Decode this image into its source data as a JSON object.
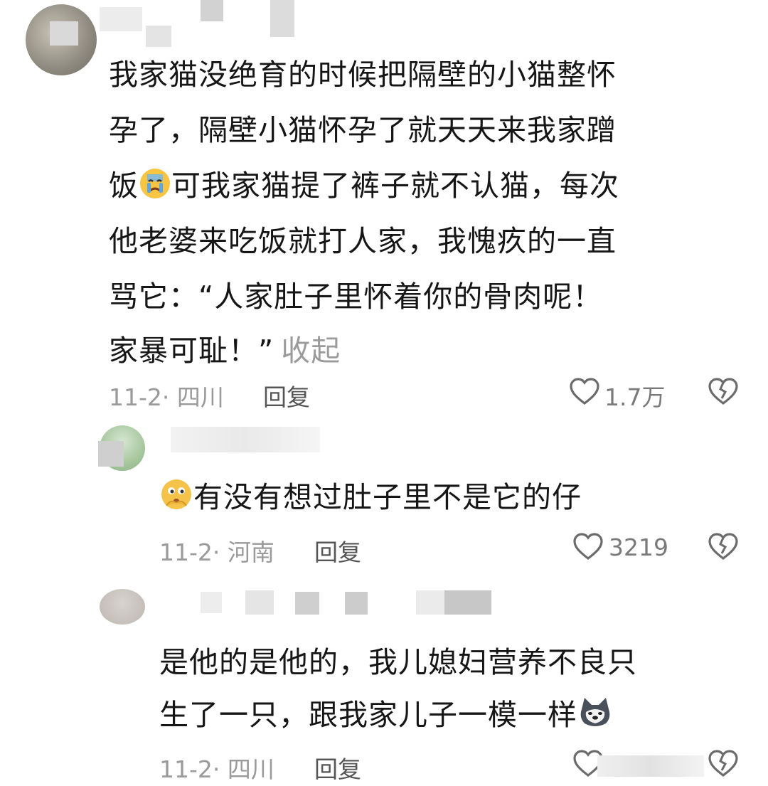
{
  "comments": [
    {
      "text_lines": [
        "我家猫没绝育的时候把隔壁的小猫整怀",
        "孕了，隔壁小猫怀孕了就天天来我家蹭",
        "可我家猫提了裤子就不认猫，每次",
        "他老婆来吃饭就打人家，我愧疚的一直",
        "骂它：“人家肚子里怀着你的骨肉呢！",
        "家暴可耻！”"
      ],
      "line3_prefix": "饭",
      "emoji": "crying-face-emoji",
      "collapse_label": "收起",
      "date_location": "11-2· 四川",
      "reply_label": "回复",
      "likes": "1.7万"
    },
    {
      "emoji": "thinking-face-emoji",
      "text": "有没有想过肚子里不是它的仔",
      "date_location": "11-2· 河南",
      "reply_label": "回复",
      "likes": "3219"
    },
    {
      "text_lines": [
        "是他的是他的，我儿媳妇营养不良只",
        "生了一只，跟我家儿子一模一样"
      ],
      "emoji": "husky-dog-emoji",
      "date_location": "11-2· 四川",
      "reply_label": "回复"
    }
  ],
  "colors": {
    "text": "#161616",
    "meta": "#9a9a9a",
    "icon": "#6b6b6b"
  }
}
